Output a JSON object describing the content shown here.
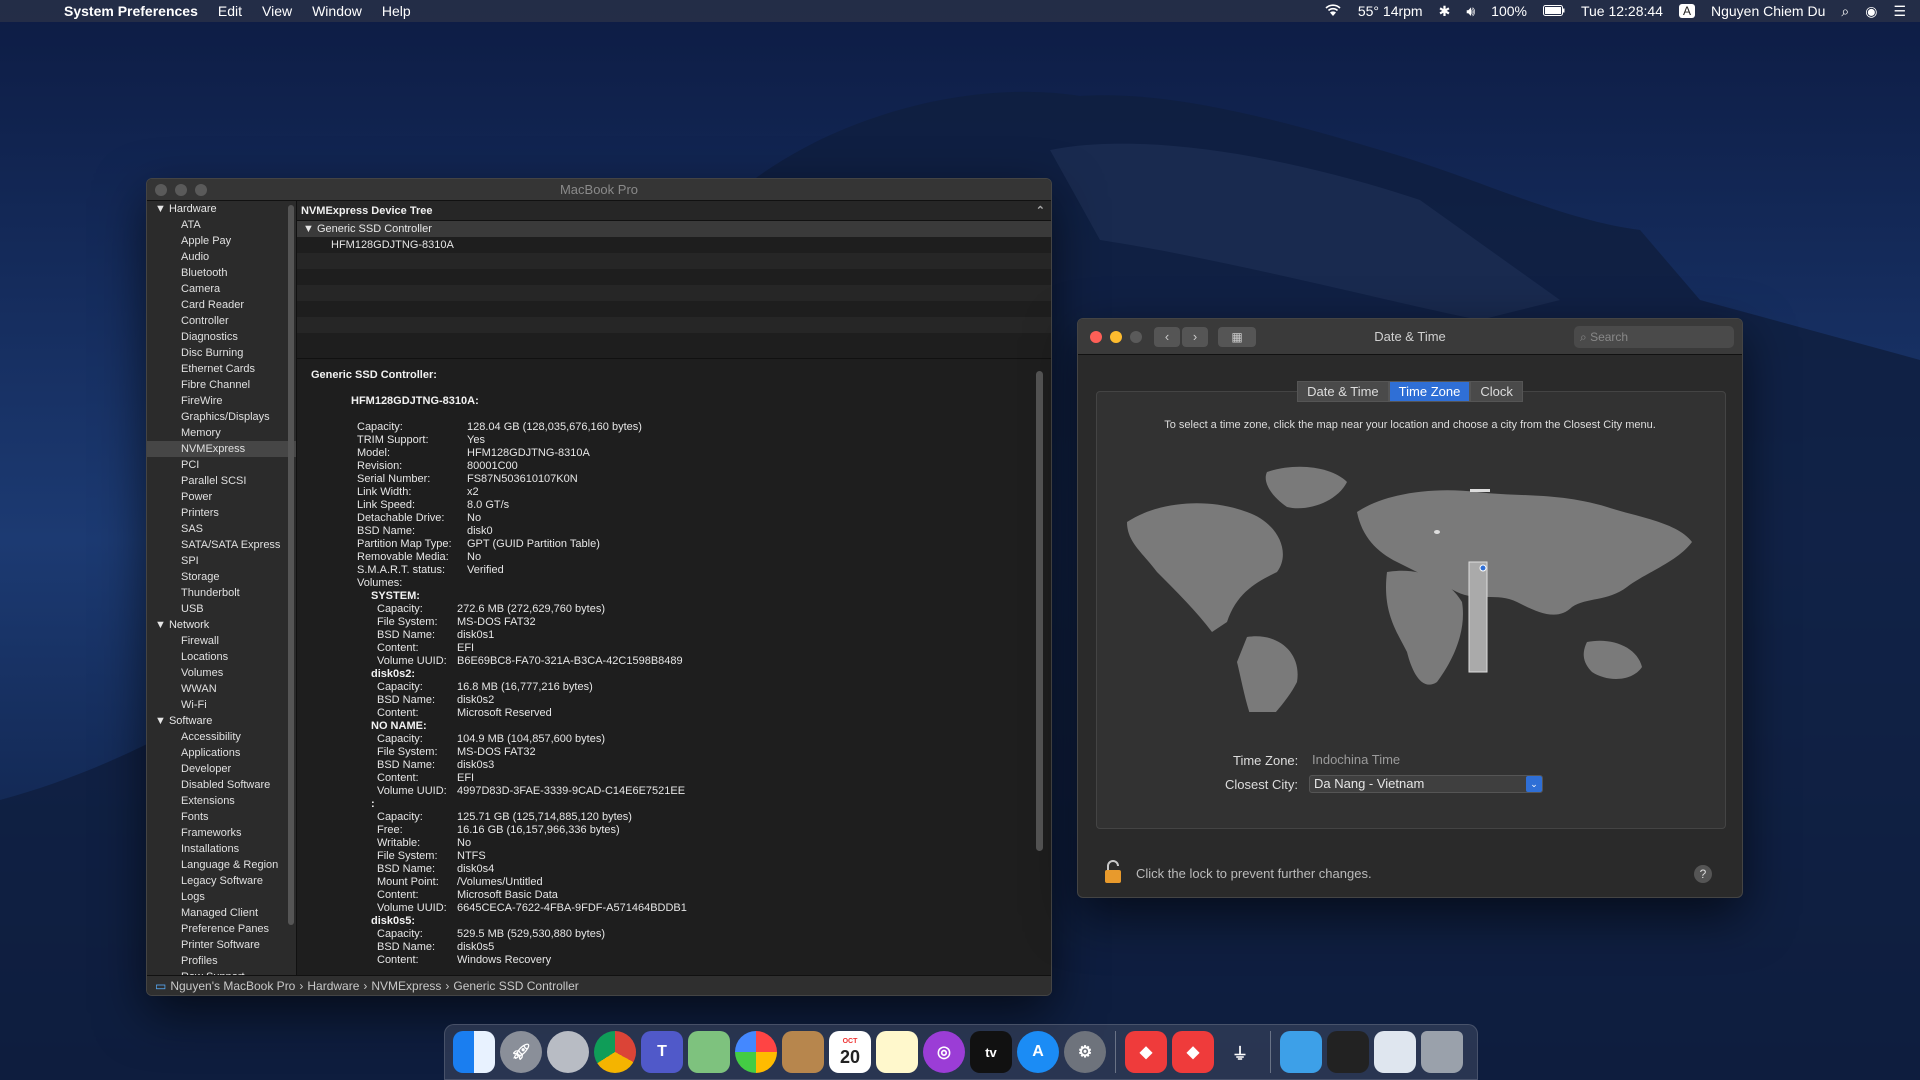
{
  "menubar": {
    "app_name": "System Preferences",
    "menus": [
      "Edit",
      "View",
      "Window",
      "Help"
    ],
    "status": {
      "weather": "55° 14rpm",
      "battery": "100%",
      "clock": "Tue 12:28:44",
      "input": "A",
      "user": "Nguyen Chiem Du"
    }
  },
  "sysinfo": {
    "title": "MacBook Pro",
    "sidebar": {
      "hardware_label": "Hardware",
      "hardware_items": [
        "ATA",
        "Apple Pay",
        "Audio",
        "Bluetooth",
        "Camera",
        "Card Reader",
        "Controller",
        "Diagnostics",
        "Disc Burning",
        "Ethernet Cards",
        "Fibre Channel",
        "FireWire",
        "Graphics/Displays",
        "Memory",
        "NVMExpress",
        "PCI",
        "Parallel SCSI",
        "Power",
        "Printers",
        "SAS",
        "SATA/SATA Express",
        "SPI",
        "Storage",
        "Thunderbolt",
        "USB"
      ],
      "network_label": "Network",
      "network_items": [
        "Firewall",
        "Locations",
        "Volumes",
        "WWAN",
        "Wi-Fi"
      ],
      "software_label": "Software",
      "software_items": [
        "Accessibility",
        "Applications",
        "Developer",
        "Disabled Software",
        "Extensions",
        "Fonts",
        "Frameworks",
        "Installations",
        "Language & Region",
        "Legacy Software",
        "Logs",
        "Managed Client",
        "Preference Panes",
        "Printer Software",
        "Profiles",
        "Raw Support"
      ]
    },
    "tree": {
      "header": "NVMExpress Device Tree",
      "controller": "Generic SSD Controller",
      "device": "HFM128GDJTNG-8310A"
    },
    "detail": {
      "heading": "Generic SSD Controller:",
      "device_heading": "HFM128GDJTNG-8310A:",
      "props": [
        [
          "Capacity:",
          "128.04 GB (128,035,676,160 bytes)"
        ],
        [
          "TRIM Support:",
          "Yes"
        ],
        [
          "Model:",
          "HFM128GDJTNG-8310A"
        ],
        [
          "Revision:",
          "80001C00"
        ],
        [
          "Serial Number:",
          "FS87N503610107K0N"
        ],
        [
          "Link Width:",
          "x2"
        ],
        [
          "Link Speed:",
          "8.0 GT/s"
        ],
        [
          "Detachable Drive:",
          "No"
        ],
        [
          "BSD Name:",
          "disk0"
        ],
        [
          "Partition Map Type:",
          "GPT (GUID Partition Table)"
        ],
        [
          "Removable Media:",
          "No"
        ],
        [
          "S.M.A.R.T. status:",
          "Verified"
        ],
        [
          "Volumes:",
          ""
        ]
      ],
      "volumes": [
        {
          "name": "SYSTEM:",
          "props": [
            [
              "Capacity:",
              "272.6 MB (272,629,760 bytes)"
            ],
            [
              "File System:",
              "MS-DOS FAT32"
            ],
            [
              "BSD Name:",
              "disk0s1"
            ],
            [
              "Content:",
              "EFI"
            ],
            [
              "Volume UUID:",
              "B6E69BC8-FA70-321A-B3CA-42C1598B8489"
            ]
          ]
        },
        {
          "name": "disk0s2:",
          "props": [
            [
              "Capacity:",
              "16.8 MB (16,777,216 bytes)"
            ],
            [
              "BSD Name:",
              "disk0s2"
            ],
            [
              "Content:",
              "Microsoft Reserved"
            ]
          ]
        },
        {
          "name": "NO NAME:",
          "props": [
            [
              "Capacity:",
              "104.9 MB (104,857,600 bytes)"
            ],
            [
              "File System:",
              "MS-DOS FAT32"
            ],
            [
              "BSD Name:",
              "disk0s3"
            ],
            [
              "Content:",
              "EFI"
            ],
            [
              "Volume UUID:",
              "4997D83D-3FAE-3339-9CAD-C14E6E7521EE"
            ]
          ]
        },
        {
          "name": ":",
          "props": [
            [
              "Capacity:",
              "125.71 GB (125,714,885,120 bytes)"
            ],
            [
              "Free:",
              "16.16 GB (16,157,966,336 bytes)"
            ],
            [
              "Writable:",
              "No"
            ],
            [
              "File System:",
              "NTFS"
            ],
            [
              "BSD Name:",
              "disk0s4"
            ],
            [
              "Mount Point:",
              "/Volumes/Untitled"
            ],
            [
              "Content:",
              "Microsoft Basic Data"
            ],
            [
              "Volume UUID:",
              "6645CECA-7622-4FBA-9FDF-A571464BDDB1"
            ]
          ]
        },
        {
          "name": "disk0s5:",
          "props": [
            [
              "Capacity:",
              "529.5 MB (529,530,880 bytes)"
            ],
            [
              "BSD Name:",
              "disk0s5"
            ],
            [
              "Content:",
              "Windows Recovery"
            ]
          ]
        }
      ]
    },
    "breadcrumb": [
      "Nguyen's MacBook Pro",
      "Hardware",
      "NVMExpress",
      "Generic SSD Controller"
    ]
  },
  "datetime": {
    "title": "Date & Time",
    "search_placeholder": "Search",
    "tabs": [
      "Date & Time",
      "Time Zone",
      "Clock"
    ],
    "active_tab": "Time Zone",
    "instruction": "To select a time zone, click the map near your location and choose a city from the Closest City menu.",
    "time_zone_label": "Time Zone:",
    "time_zone_value": "Indochina Time",
    "closest_city_label": "Closest City:",
    "closest_city_value": "Da Nang - Vietnam",
    "lock_text": "Click the lock to prevent further changes.",
    "help": "?"
  },
  "dock": {
    "apps": [
      "finder-icon",
      "launchpad-icon",
      "dvd-icon",
      "chrome-icon",
      "teams-icon",
      "maps-icon",
      "photos-icon",
      "contacts-icon",
      "calendar-icon",
      "notes-icon",
      "podcasts-icon",
      "apple-tv-icon",
      "app-store-icon",
      "system-preferences-icon",
      "anydesk-icon",
      "anydesk2-icon",
      "network-icon",
      "folder-icon",
      "terminal-icon",
      "browser-icon",
      "trash-icon"
    ],
    "calendar_month": "OCT",
    "calendar_day": "20",
    "tv_label": "tv"
  }
}
